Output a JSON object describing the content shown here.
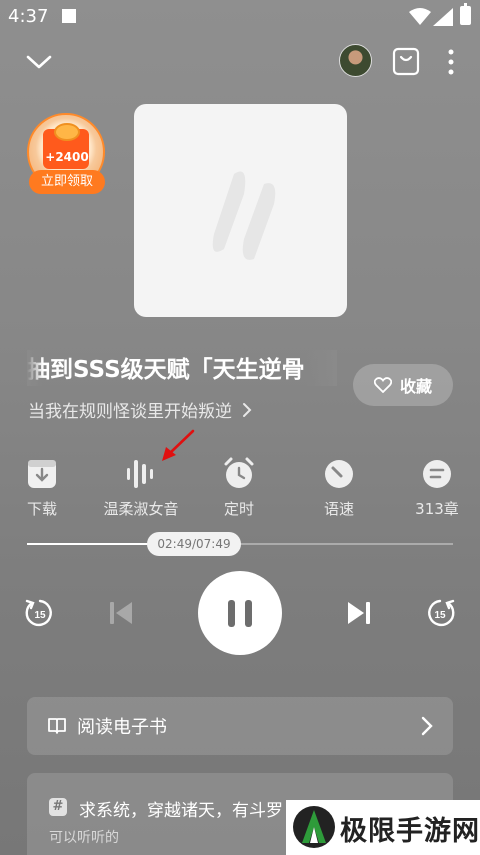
{
  "status_bar": {
    "time": "4:37"
  },
  "top_bar": {
    "collapse_icon": "chevron-down-icon",
    "cart_icon": "shopping-bag-icon",
    "more_icon": "more-vertical-icon"
  },
  "reward": {
    "points": "+2400",
    "claim_label": "立即领取"
  },
  "book": {
    "title": "抽到SSS级天赋「天生逆骨",
    "subtitle": "当我在规则怪谈里开始叛逆",
    "favorite_label": "收藏"
  },
  "actions": [
    {
      "label": "下载",
      "icon": "download-icon"
    },
    {
      "label": "温柔淑女音",
      "icon": "voice-wave-icon"
    },
    {
      "label": "定时",
      "icon": "alarm-clock-icon"
    },
    {
      "label": "语速",
      "icon": "speed-gauge-icon"
    },
    {
      "label": "313章",
      "icon": "chapter-list-icon"
    }
  ],
  "progress": {
    "time": "02:49/07:49",
    "fraction": 0.36
  },
  "controls": {
    "rewind_seconds": "15",
    "forward_seconds": "15"
  },
  "read_ebook": {
    "label": "阅读电子书"
  },
  "recommendation": {
    "tag": "#",
    "title": "求系统，穿越诸天，有斗罗",
    "subtitle": "可以听听的"
  },
  "watermark": {
    "text": "极限手游网"
  },
  "colors": {
    "background": "#8a8a8a",
    "reward_orange": "#ff7a1f",
    "watermark_green": "#2e9b3a"
  }
}
